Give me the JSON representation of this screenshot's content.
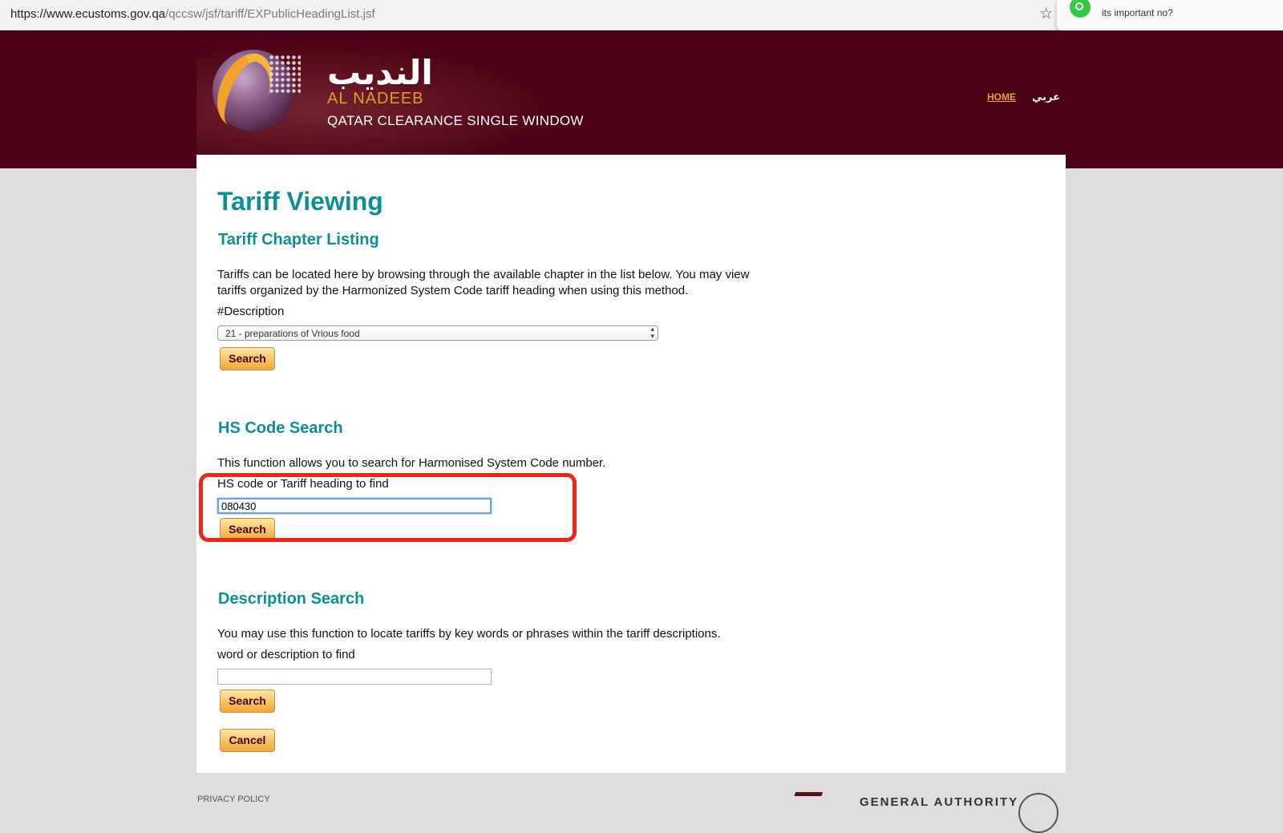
{
  "browser": {
    "url_host": "https://www.ecustoms.gov.qa",
    "url_path": "/qccsw/jsf/tariff/EXPublicHeadingList.jsf",
    "notification_text": "its important no?"
  },
  "header": {
    "logo_arabic": "النديب",
    "logo_english": "AL NADEEB",
    "logo_subtitle": "QATAR CLEARANCE SINGLE WINDOW",
    "nav_home": "HOME",
    "nav_arabic": "عربي"
  },
  "main": {
    "page_title": "Tariff Viewing",
    "chapter_listing": {
      "title": "Tariff Chapter Listing",
      "description": "Tariffs can be located here by browsing through the available chapter in the list below. You may view tariffs organized by the Harmonized System Code tariff heading when using this method.",
      "field_label": "#Description",
      "selected_option": "21 - preparations of Vrious food",
      "search_label": "Search"
    },
    "hs_code_search": {
      "title": "HS Code Search",
      "description": "This function allows you to search for Harmonised System Code number.",
      "field_label": "HS code or Tariff heading to find",
      "field_value": "080430",
      "search_label": "Search"
    },
    "description_search": {
      "title": "Description Search",
      "description": "You may use this function to locate tariffs by key words or phrases within the tariff descriptions.",
      "field_label": "word or description to find",
      "field_value": "",
      "search_label": "Search",
      "cancel_label": "Cancel"
    }
  },
  "footer": {
    "privacy_policy": "PRIVACY POLICY",
    "authority_text": "GENERAL AUTHORITY"
  },
  "colors": {
    "header_bg": "#4a0113",
    "accent_teal": "#0d8e95",
    "button_orange": "#f7bf5f",
    "highlight_red": "#f0241c"
  }
}
